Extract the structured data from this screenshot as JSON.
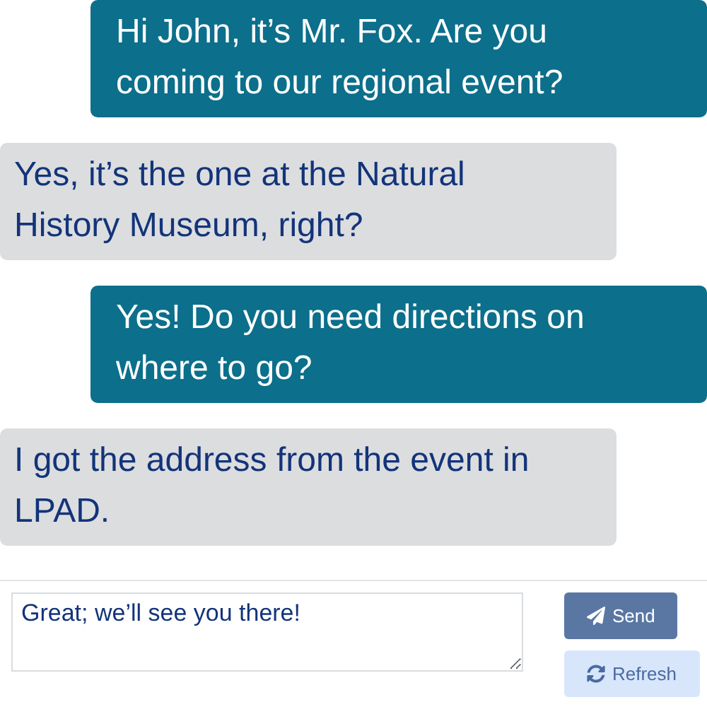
{
  "messages": [
    {
      "text": "Hi John, it’s Mr. Fox. Are you coming to our regional event?",
      "kind": "sent"
    },
    {
      "text": "Yes, it’s the one at the Natural History Museum, right?",
      "kind": "received"
    },
    {
      "text": "Yes! Do you need directions on where to go?",
      "kind": "sent"
    },
    {
      "text": "I got the address from the event in LPAD.",
      "kind": "received"
    }
  ],
  "composer": {
    "value": "Great; we’ll see you there!",
    "send_label": "Send",
    "refresh_label": "Refresh"
  }
}
